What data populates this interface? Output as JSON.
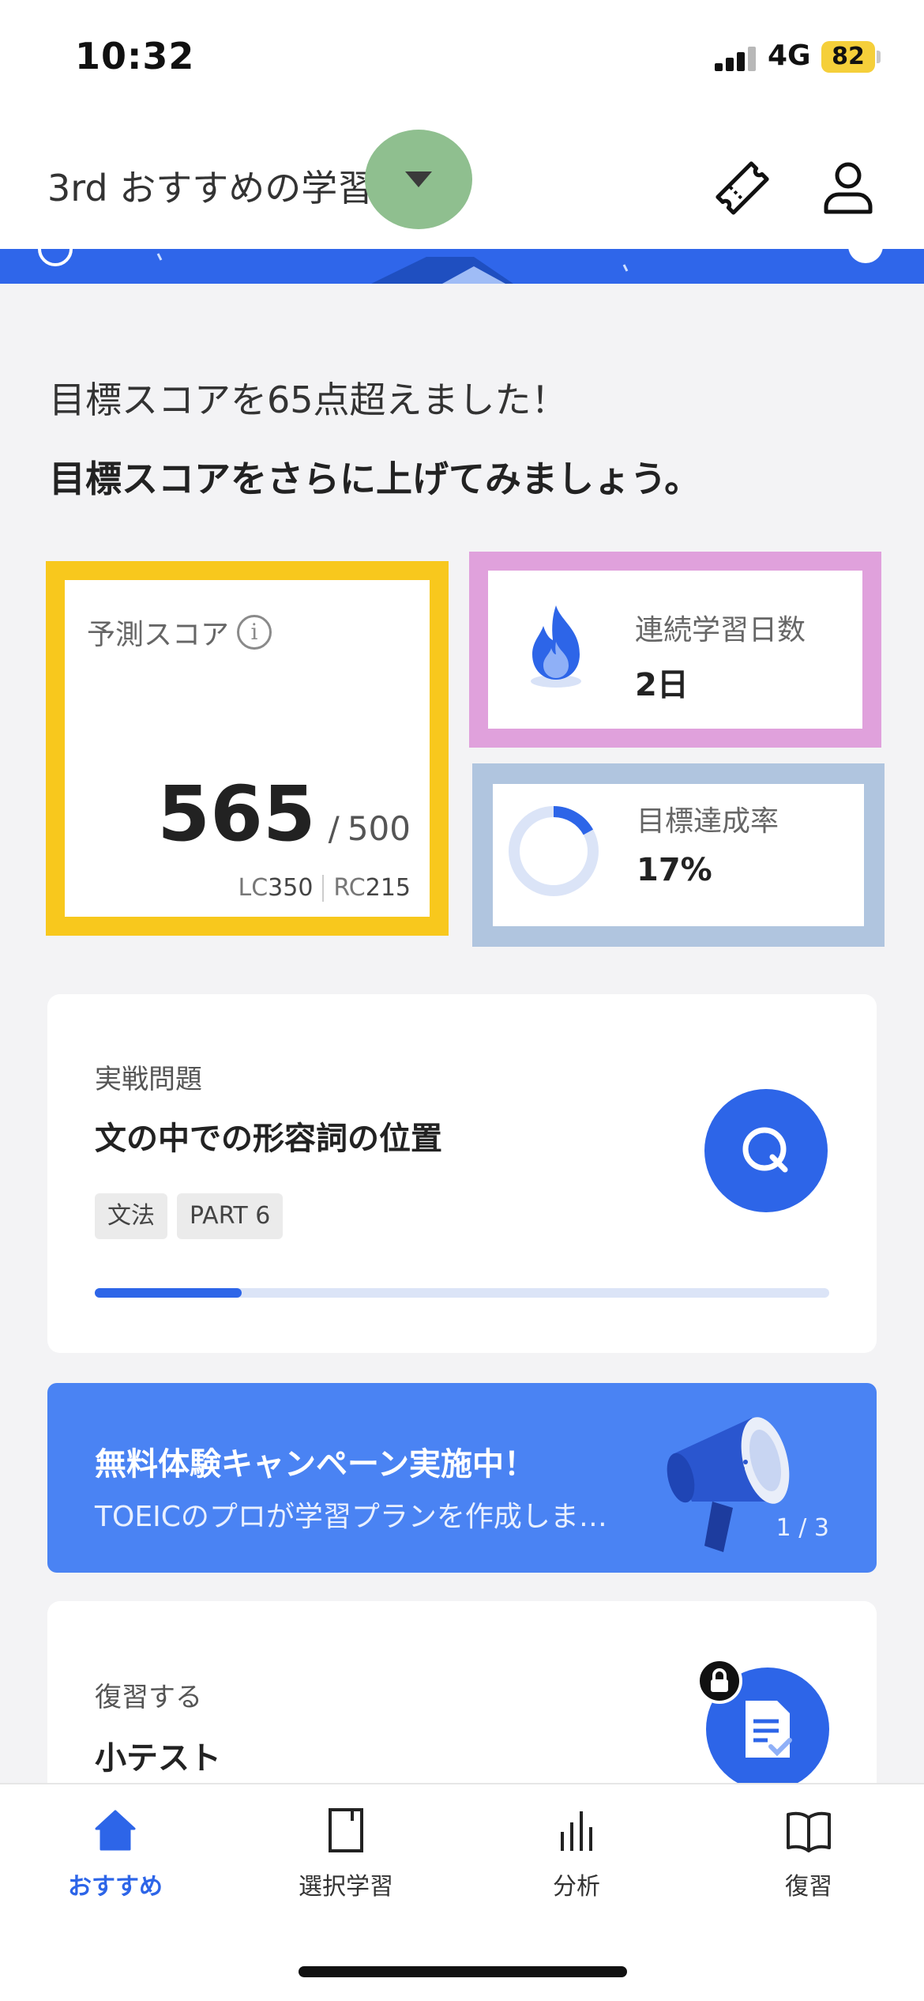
{
  "status_bar": {
    "time": "10:32",
    "network": "4G",
    "battery": "82"
  },
  "header": {
    "title": "3rd おすすめの学習"
  },
  "goal_message": {
    "line1": "目標スコアを65点超えました！",
    "line2": "目標スコアをさらに上げてみましょう。"
  },
  "score_card": {
    "label": "予測スコア",
    "info": "i",
    "score": "565",
    "separator": "/",
    "max": "500",
    "lc_label": "LC",
    "lc_value": "350",
    "rc_label": "RC",
    "rc_value": "215"
  },
  "streak_card": {
    "label": "連続学習日数",
    "value": "2日"
  },
  "goal_rate_card": {
    "label": "目標達成率",
    "value": "17%",
    "progress": 0.17
  },
  "practice_card": {
    "category": "実戦問題",
    "title": "文の中での形容詞の位置",
    "tags": [
      "文法",
      "PART 6"
    ],
    "progress": 0.2
  },
  "campaign": {
    "title": "無料体験キャンペーン実施中！",
    "subtitle": "TOEICのプロが学習プランを作成しま…",
    "pager": "1 / 3"
  },
  "review_card": {
    "category": "復習する",
    "title": "小テスト"
  },
  "tab_bar": {
    "items": [
      {
        "label": "おすすめ",
        "icon": "home-icon",
        "active": true
      },
      {
        "label": "選択学習",
        "icon": "book-select-icon",
        "active": false
      },
      {
        "label": "分析",
        "icon": "bar-chart-icon",
        "active": false
      },
      {
        "label": "復習",
        "icon": "open-book-icon",
        "active": false
      }
    ]
  },
  "colors": {
    "accent": "#2d65e8",
    "score_highlight": "#f8c81d",
    "streak_highlight": "#e0a1dc",
    "rate_highlight": "#b0c5df",
    "dropdown_highlight": "#8fbf8f"
  }
}
